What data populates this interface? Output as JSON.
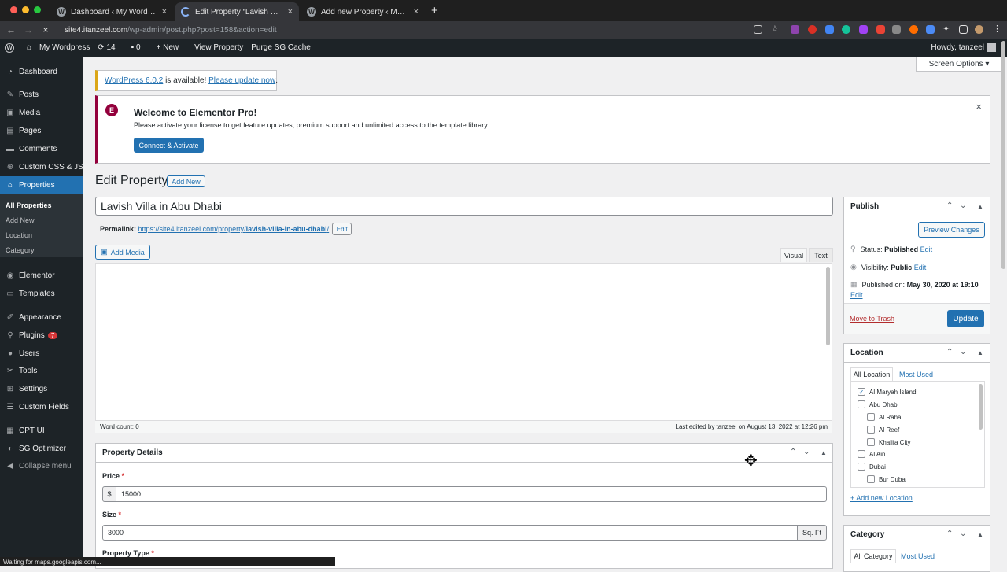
{
  "browser": {
    "tabs": [
      {
        "title": "Dashboard ‹ My Wordpress —"
      },
      {
        "title": "Edit Property “Lavish Villa in A"
      },
      {
        "title": "Add new Property ‹ My Wordp"
      }
    ],
    "url_host": "site4.itanzeel.com",
    "url_path": "/wp-admin/post.php?post=158&action=edit",
    "status": "Waiting for maps.googleapis.com..."
  },
  "adminbar": {
    "site": "My Wordpress",
    "updates": "14",
    "comments": "0",
    "new": "New",
    "view": "View Property",
    "purge": "Purge SG Cache",
    "howdy": "Howdy, tanzeel"
  },
  "sidebar": {
    "items": [
      {
        "label": "Dashboard",
        "icon": "dashboard-icon"
      },
      {
        "label": "Posts",
        "icon": "pin-icon"
      },
      {
        "label": "Media",
        "icon": "media-icon"
      },
      {
        "label": "Pages",
        "icon": "page-icon"
      },
      {
        "label": "Comments",
        "icon": "comment-icon"
      },
      {
        "label": "Custom CSS & JS",
        "icon": "plus-circle-icon"
      },
      {
        "label": "Properties",
        "icon": "home-icon"
      },
      {
        "label": "Elementor",
        "icon": "elementor-icon"
      },
      {
        "label": "Templates",
        "icon": "folder-icon"
      },
      {
        "label": "Appearance",
        "icon": "brush-icon"
      },
      {
        "label": "Plugins",
        "icon": "plugin-icon",
        "badge": "7"
      },
      {
        "label": "Users",
        "icon": "user-icon"
      },
      {
        "label": "Tools",
        "icon": "wrench-icon"
      },
      {
        "label": "Settings",
        "icon": "settings-icon"
      },
      {
        "label": "Custom Fields",
        "icon": "fields-icon"
      },
      {
        "label": "CPT UI",
        "icon": "cpt-icon"
      },
      {
        "label": "SG Optimizer",
        "icon": "sg-icon"
      },
      {
        "label": "Collapse menu",
        "icon": "collapse-icon"
      }
    ],
    "submenu": [
      "All Properties",
      "Add New",
      "Location",
      "Category"
    ]
  },
  "screen_options": "Screen Options",
  "update_notice": {
    "version": "WordPress 6.0.2",
    "middle": " is available! ",
    "link": "Please update now",
    "end": "."
  },
  "elementor_notice": {
    "title": "Welcome to Elementor Pro!",
    "text": "Please activate your license to get feature updates, premium support and unlimited access to the template library.",
    "button": "Connect & Activate"
  },
  "page": {
    "heading": "Edit Property",
    "add_new": "Add New",
    "post_title": "Lavish Villa in Abu Dhabi",
    "permalink_label": "Permalink:",
    "permalink_base": "https://site4.itanzeel.com/property/",
    "permalink_slug": "lavish-villa-in-abu-dhabi",
    "permalink_end": "/",
    "permalink_edit": "Edit",
    "add_media": "Add Media",
    "tab_visual": "Visual",
    "tab_text": "Text",
    "word_count": "Word count: 0",
    "last_edited": "Last edited by tanzeel on August 13, 2022 at 12:26 pm"
  },
  "property_details": {
    "title": "Property Details",
    "price_label": "Price",
    "price_prefix": "$",
    "price_value": "15000",
    "size_label": "Size",
    "size_value": "3000",
    "size_suffix": "Sq. Ft",
    "type_label": "Property Type"
  },
  "publish": {
    "title": "Publish",
    "preview": "Preview Changes",
    "status_label": "Status:",
    "status_value": "Published",
    "visibility_label": "Visibility:",
    "visibility_value": "Public",
    "published_label": "Published on:",
    "published_value": "May 30, 2020 at 19:10",
    "edit": "Edit",
    "trash": "Move to Trash",
    "update": "Update"
  },
  "location": {
    "title": "Location",
    "tab_all": "All Location",
    "tab_used": "Most Used",
    "items": [
      {
        "label": "Al Maryah Island",
        "checked": true,
        "level": 0
      },
      {
        "label": "Abu Dhabi",
        "checked": false,
        "level": 0
      },
      {
        "label": "Al Raha",
        "checked": false,
        "level": 1
      },
      {
        "label": "Al Reef",
        "checked": false,
        "level": 1
      },
      {
        "label": "Khalifa City",
        "checked": false,
        "level": 1
      },
      {
        "label": "Al Ain",
        "checked": false,
        "level": 0
      },
      {
        "label": "Dubai",
        "checked": false,
        "level": 0
      },
      {
        "label": "Bur Dubai",
        "checked": false,
        "level": 1
      }
    ],
    "add_new": "+ Add new Location"
  },
  "category": {
    "title": "Category",
    "tab_all": "All Category",
    "tab_used": "Most Used"
  },
  "colors": {
    "accent": "#2271b1",
    "admin_bg": "#1d2327",
    "elementor": "#93003c",
    "danger": "#d63638"
  }
}
